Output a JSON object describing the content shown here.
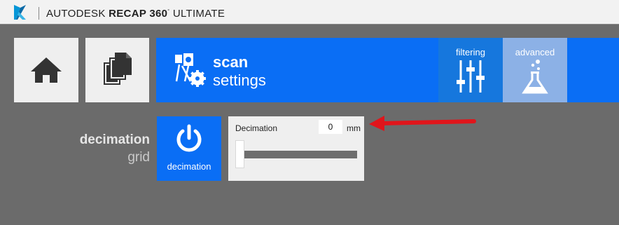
{
  "titlebar": {
    "brand": "AUTODESK",
    "product": "RECAP 360",
    "trademark": "°",
    "edition": "ULTIMATE"
  },
  "nav": {
    "home_icon": "home-icon",
    "projects_icon": "copy-pages-icon"
  },
  "banner": {
    "icon": "scan-settings-icon",
    "title": "scan",
    "subtitle": "settings",
    "tabs": [
      {
        "label": "filtering",
        "icon": "sliders-icon",
        "color": "#1677dd",
        "selected": false
      },
      {
        "label": "advanced",
        "icon": "flask-icon",
        "color": "#8cb1e6",
        "selected": true
      }
    ]
  },
  "section": {
    "title": "decimation",
    "subtitle": "grid"
  },
  "toggle": {
    "label": "decimation",
    "icon": "power-icon"
  },
  "decimation_panel": {
    "label": "Decimation",
    "value": "0",
    "unit": "mm",
    "slider_fraction": 0.0
  },
  "annotation": {
    "arrow_color": "#e0151b"
  },
  "colors": {
    "accent": "#0a6ef5",
    "background": "#6b6b6b"
  }
}
